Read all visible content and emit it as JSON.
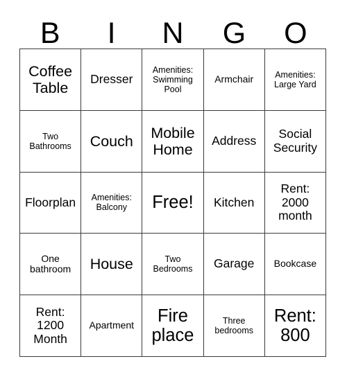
{
  "card": {
    "headers": [
      "B",
      "I",
      "N",
      "G",
      "O"
    ],
    "rows": [
      [
        {
          "text": "Coffee Table",
          "size": "fs-lg"
        },
        {
          "text": "Dresser",
          "size": "fs-md"
        },
        {
          "text": "Amenities: Swimming Pool",
          "size": "fs-xs"
        },
        {
          "text": "Armchair",
          "size": "fs-sm"
        },
        {
          "text": "Amenities: Large Yard",
          "size": "fs-xs"
        }
      ],
      [
        {
          "text": "Two Bathrooms",
          "size": "fs-xs"
        },
        {
          "text": "Couch",
          "size": "fs-lg"
        },
        {
          "text": "Mobile Home",
          "size": "fs-lg"
        },
        {
          "text": "Address",
          "size": "fs-md"
        },
        {
          "text": "Social Security",
          "size": "fs-md"
        }
      ],
      [
        {
          "text": "Floorplan",
          "size": "fs-md"
        },
        {
          "text": "Amenities: Balcony",
          "size": "fs-xs"
        },
        {
          "text": "Free!",
          "size": "fs-xl"
        },
        {
          "text": "Kitchen",
          "size": "fs-md"
        },
        {
          "text": "Rent: 2000 month",
          "size": "fs-md"
        }
      ],
      [
        {
          "text": "One bathroom",
          "size": "fs-sm"
        },
        {
          "text": "House",
          "size": "fs-lg"
        },
        {
          "text": "Two Bedrooms",
          "size": "fs-xs"
        },
        {
          "text": "Garage",
          "size": "fs-md"
        },
        {
          "text": "Bookcase",
          "size": "fs-sm"
        }
      ],
      [
        {
          "text": "Rent: 1200 Month",
          "size": "fs-md"
        },
        {
          "text": "Apartment",
          "size": "fs-sm"
        },
        {
          "text": "Fire place",
          "size": "fs-xl"
        },
        {
          "text": "Three bedrooms",
          "size": "fs-xs"
        },
        {
          "text": "Rent: 800",
          "size": "fs-xl"
        }
      ]
    ],
    "colors": {
      "text": "#000000",
      "border": "#3a3a3a",
      "background": "#ffffff"
    }
  }
}
